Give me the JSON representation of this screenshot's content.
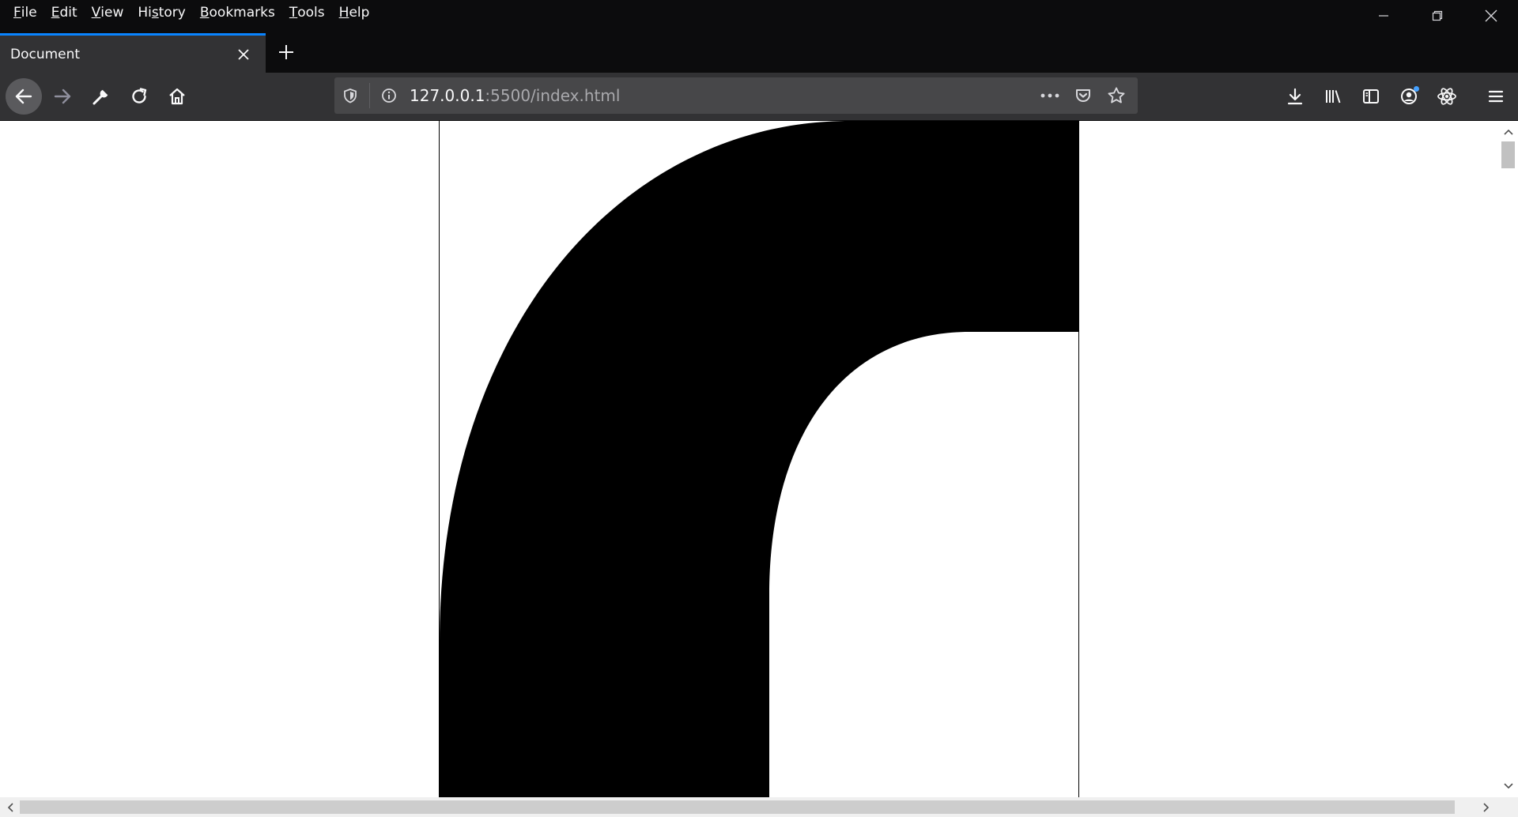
{
  "menu": {
    "items": [
      {
        "accel": "F",
        "rest": "ile"
      },
      {
        "accel": "E",
        "rest": "dit"
      },
      {
        "accel": "V",
        "rest": "iew"
      },
      {
        "pre": "Hi",
        "accel": "s",
        "rest": "tory"
      },
      {
        "accel": "B",
        "rest": "ookmarks"
      },
      {
        "accel": "T",
        "rest": "ools"
      },
      {
        "accel": "H",
        "rest": "elp"
      }
    ]
  },
  "window_controls": [
    "minimize-icon",
    "restore-icon",
    "close-icon"
  ],
  "tab": {
    "title": "Document",
    "active_accent": "#0a84ff"
  },
  "navbar": {
    "url_host": "127.0.0.1",
    "url_rest": ":5500/index.html",
    "left_icons": [
      "back-arrow-icon",
      "forward-arrow-icon",
      "wrench-icon",
      "reload-icon",
      "home-icon"
    ],
    "url_icons": [
      "shield-icon",
      "info-icon",
      "more-dots-icon",
      "pocket-icon",
      "star-icon"
    ],
    "right_icons": [
      "download-icon",
      "library-icon",
      "sidebar-icon",
      "account-icon",
      "react-devtools-icon",
      "hamburger-menu-icon"
    ]
  },
  "colors": {
    "chrome_dark": "#0c0c0d",
    "toolbar": "#323234",
    "urlbar": "#474749",
    "page_bg": "#ffffff",
    "shape": "#000000"
  }
}
